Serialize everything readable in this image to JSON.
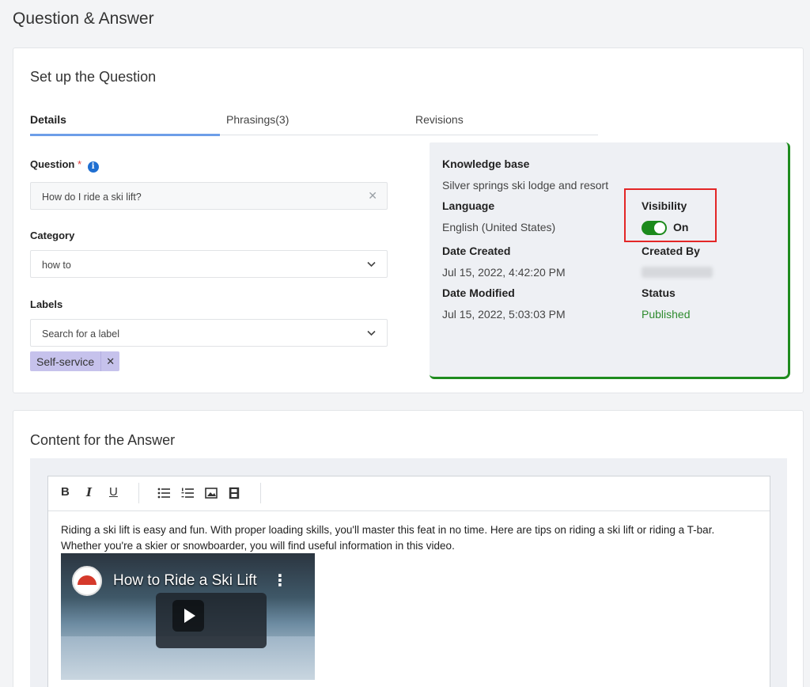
{
  "page": {
    "title": "Question & Answer"
  },
  "setup": {
    "title": "Set up the Question",
    "tabs": [
      {
        "label": "Details",
        "active": true
      },
      {
        "label": "Phrasings(3)",
        "active": false
      },
      {
        "label": "Revisions",
        "active": false
      }
    ],
    "question": {
      "label": "Question",
      "required_marker": "*",
      "value": "How do I ride a ski lift?",
      "clear_glyph": "✕"
    },
    "category": {
      "label": "Category",
      "value": "how to"
    },
    "labels": {
      "label": "Labels",
      "placeholder": "Search for a label",
      "chips": [
        {
          "label": "Self-service",
          "remove_glyph": "✕"
        }
      ]
    }
  },
  "kb_panel": {
    "accent_color": "#1e8b1e",
    "knowledge_base": {
      "label": "Knowledge base",
      "value": "Silver springs ski lodge and resort"
    },
    "language": {
      "label": "Language",
      "value": "English (United States)"
    },
    "visibility": {
      "label": "Visibility",
      "value": "On",
      "enabled": true
    },
    "date_created": {
      "label": "Date Created",
      "value": "Jul 15, 2022, 4:42:20 PM"
    },
    "created_by": {
      "label": "Created By"
    },
    "date_modified": {
      "label": "Date Modified",
      "value": "Jul 15, 2022, 5:03:03 PM"
    },
    "status": {
      "label": "Status",
      "value": "Published",
      "color": "#2e8b2e"
    }
  },
  "answer": {
    "title": "Content for the Answer",
    "toolbar": {
      "bold": "B",
      "italic": "I",
      "underline": "U"
    },
    "body_text": "Riding a ski lift is easy and fun. With proper loading skills, you'll master this feat in no time. Here are tips on riding a ski lift or riding a T-bar. Whether you're a skier or snowboarder, you will find useful information in this video.",
    "video": {
      "title": "How to Ride a Ski Lift"
    }
  }
}
